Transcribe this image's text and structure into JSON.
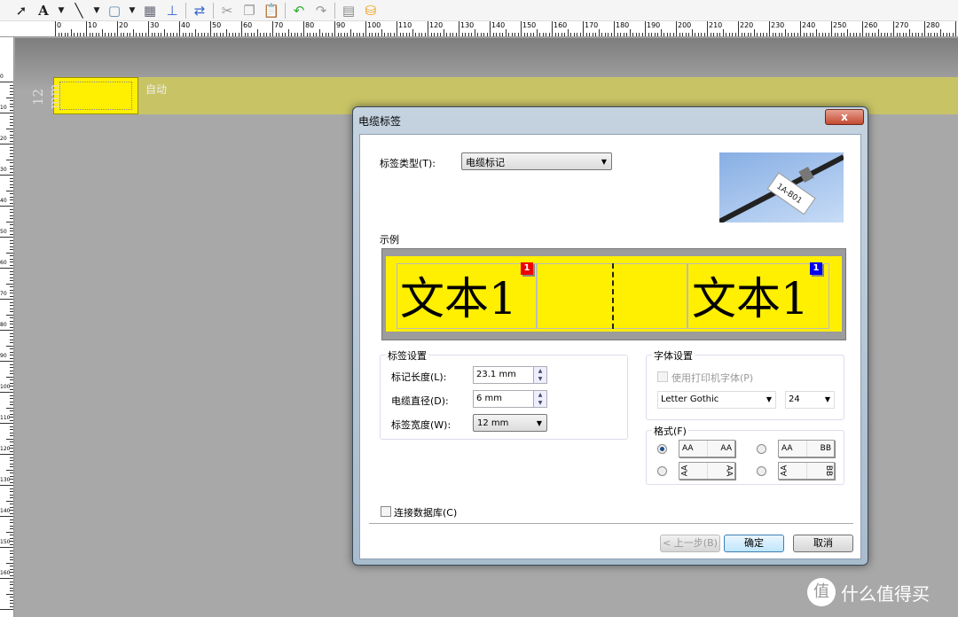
{
  "toolbar": {
    "icons": [
      "pointer-icon",
      "text-icon",
      "line-icon",
      "rectangle-icon",
      "table-icon",
      "barcode-icon",
      "rotate-icon",
      "cut-icon",
      "copy-icon",
      "paste-icon",
      "undo-icon",
      "redo-icon",
      "align-icon",
      "database-icon"
    ]
  },
  "ruler": {
    "unit": "mm",
    "h_ticks": [
      "0",
      "10",
      "20",
      "30",
      "40",
      "50",
      "60",
      "70",
      "80",
      "90",
      "100",
      "110",
      "120",
      "130",
      "140",
      "150",
      "160",
      "170",
      "180",
      "190",
      "200",
      "210",
      "220",
      "230",
      "240",
      "250",
      "260",
      "270",
      "280"
    ],
    "v_ticks": [
      "0",
      "10",
      "20",
      "30",
      "40",
      "50",
      "60",
      "70",
      "80",
      "90",
      "100",
      "110",
      "120",
      "130",
      "140",
      "150",
      "160"
    ]
  },
  "canvas": {
    "tape_width": "12 mm",
    "auto_label": "自动",
    "label_color": "#ffef00",
    "strip_color": "#c8c466"
  },
  "dialog": {
    "title": "电缆标签",
    "close": "x",
    "label_type_label": "标签类型(T):",
    "label_type_value": "电缆标记",
    "photo_text": "1A-B01",
    "example_label": "示例",
    "preview": {
      "text_left": "文本1",
      "text_right": "文本1",
      "badge_left": "1",
      "badge_right": "1",
      "badge_left_color": "#ee0000",
      "badge_right_color": "#0000ee"
    },
    "label_settings": {
      "title": "标签设置",
      "length_label": "标记长度(L):",
      "length_value": "23.1 mm",
      "diameter_label": "电缆直径(D):",
      "diameter_value": "6 mm",
      "width_label": "标签宽度(W):",
      "width_value": "12 mm"
    },
    "font_settings": {
      "title": "字体设置",
      "printer_font_label": "使用打印机字体(P)",
      "printer_font_checked": false,
      "font_value": "Letter Gothic",
      "size_value": "24"
    },
    "format": {
      "title": "格式(F)",
      "options": [
        {
          "left": "AA",
          "right": "AA",
          "selected": true,
          "rotated": false
        },
        {
          "left": "AA",
          "right": "BB",
          "selected": false,
          "rotated": false
        },
        {
          "left": "AA",
          "right": "AA",
          "selected": false,
          "rotated": true
        },
        {
          "left": "AA",
          "right": "BB",
          "selected": false,
          "rotated": true
        }
      ]
    },
    "connect_db_label": "连接数据库(C)",
    "connect_db_checked": false,
    "back_button": "< 上一步(B)",
    "ok_button": "确定",
    "cancel_button": "取消"
  },
  "watermark": {
    "text": "什么值得买",
    "logo": "值"
  }
}
